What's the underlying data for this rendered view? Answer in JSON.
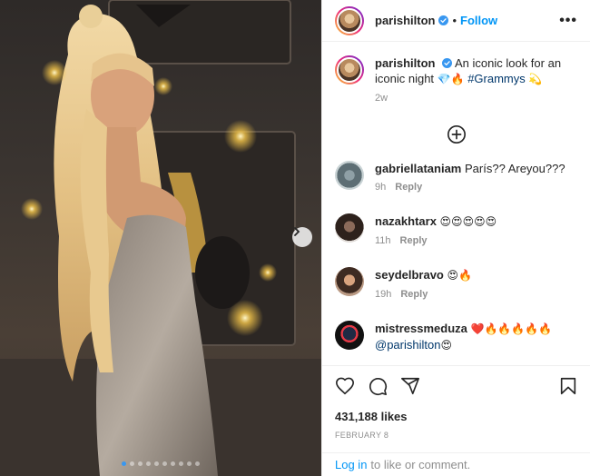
{
  "post": {
    "username": "parishilton",
    "follow_label": "Follow",
    "separator": "•",
    "more_label": "•••",
    "caption_text": "An iconic look for an iconic night",
    "caption_emoji": "💎🔥",
    "caption_hashtag": "#Grammys",
    "caption_emoji_end": "💫",
    "caption_time": "2w",
    "likes": "431,188 likes",
    "date": "FEBRUARY 8"
  },
  "comments": [
    {
      "username": "gabriellataniam",
      "text": "París?? Areyou???",
      "time": "9h",
      "reply": "Reply"
    },
    {
      "username": "nazakhtarx",
      "text": "😍😍😍😍😍",
      "time": "11h",
      "reply": "Reply"
    },
    {
      "username": "seydelbravo",
      "text": "😍🔥",
      "time": "19h",
      "reply": "Reply"
    },
    {
      "username": "mistressmeduza",
      "text": "❤️🔥🔥🔥🔥🔥",
      "mention": "@parishilton",
      "mention_emoji": "😍"
    }
  ],
  "login": {
    "link": "Log in",
    "text": "to like or comment."
  },
  "carousel": {
    "total": 10,
    "active": 0
  },
  "colors": {
    "accent": "#0095f6",
    "verified": "#3897f0",
    "meta": "#8e8e8e"
  },
  "icons": [
    "more-icon",
    "verified-icon",
    "add-comment-icon",
    "heart-icon",
    "comment-icon",
    "share-icon",
    "bookmark-icon",
    "next-arrow-icon"
  ]
}
